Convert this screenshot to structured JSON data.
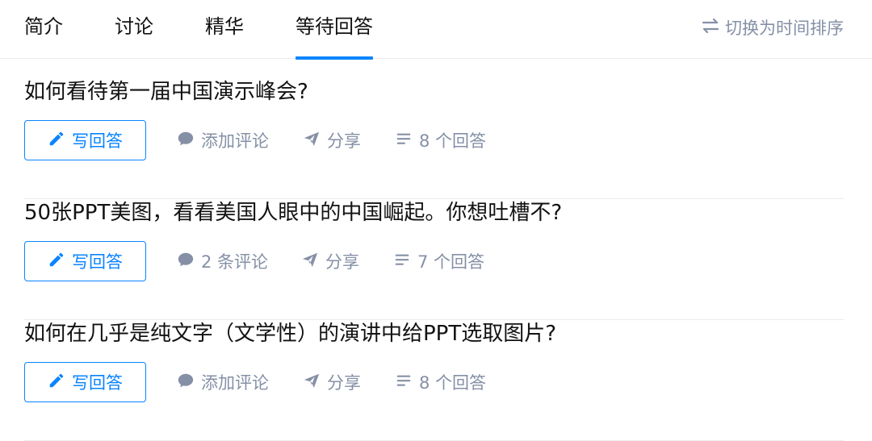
{
  "tabs": [
    {
      "label": "简介"
    },
    {
      "label": "讨论"
    },
    {
      "label": "精华"
    },
    {
      "label": "等待回答"
    }
  ],
  "active_tab_index": 3,
  "sort_label": "切换为时间排序",
  "accent_color": "#0a84ff",
  "muted_color": "#8590a6",
  "questions": [
    {
      "title": "如何看待第一届中国演示峰会?",
      "write_label": "写回答",
      "comment_label": "添加评论",
      "share_label": "分享",
      "answers_label": "8 个回答"
    },
    {
      "title": "50张PPT美图，看看美国人眼中的中国崛起。你想吐槽不?",
      "write_label": "写回答",
      "comment_label": "2 条评论",
      "share_label": "分享",
      "answers_label": "7 个回答"
    },
    {
      "title": "如何在几乎是纯文字（文学性）的演讲中给PPT选取图片?",
      "write_label": "写回答",
      "comment_label": "添加评论",
      "share_label": "分享",
      "answers_label": "8 个回答"
    }
  ]
}
